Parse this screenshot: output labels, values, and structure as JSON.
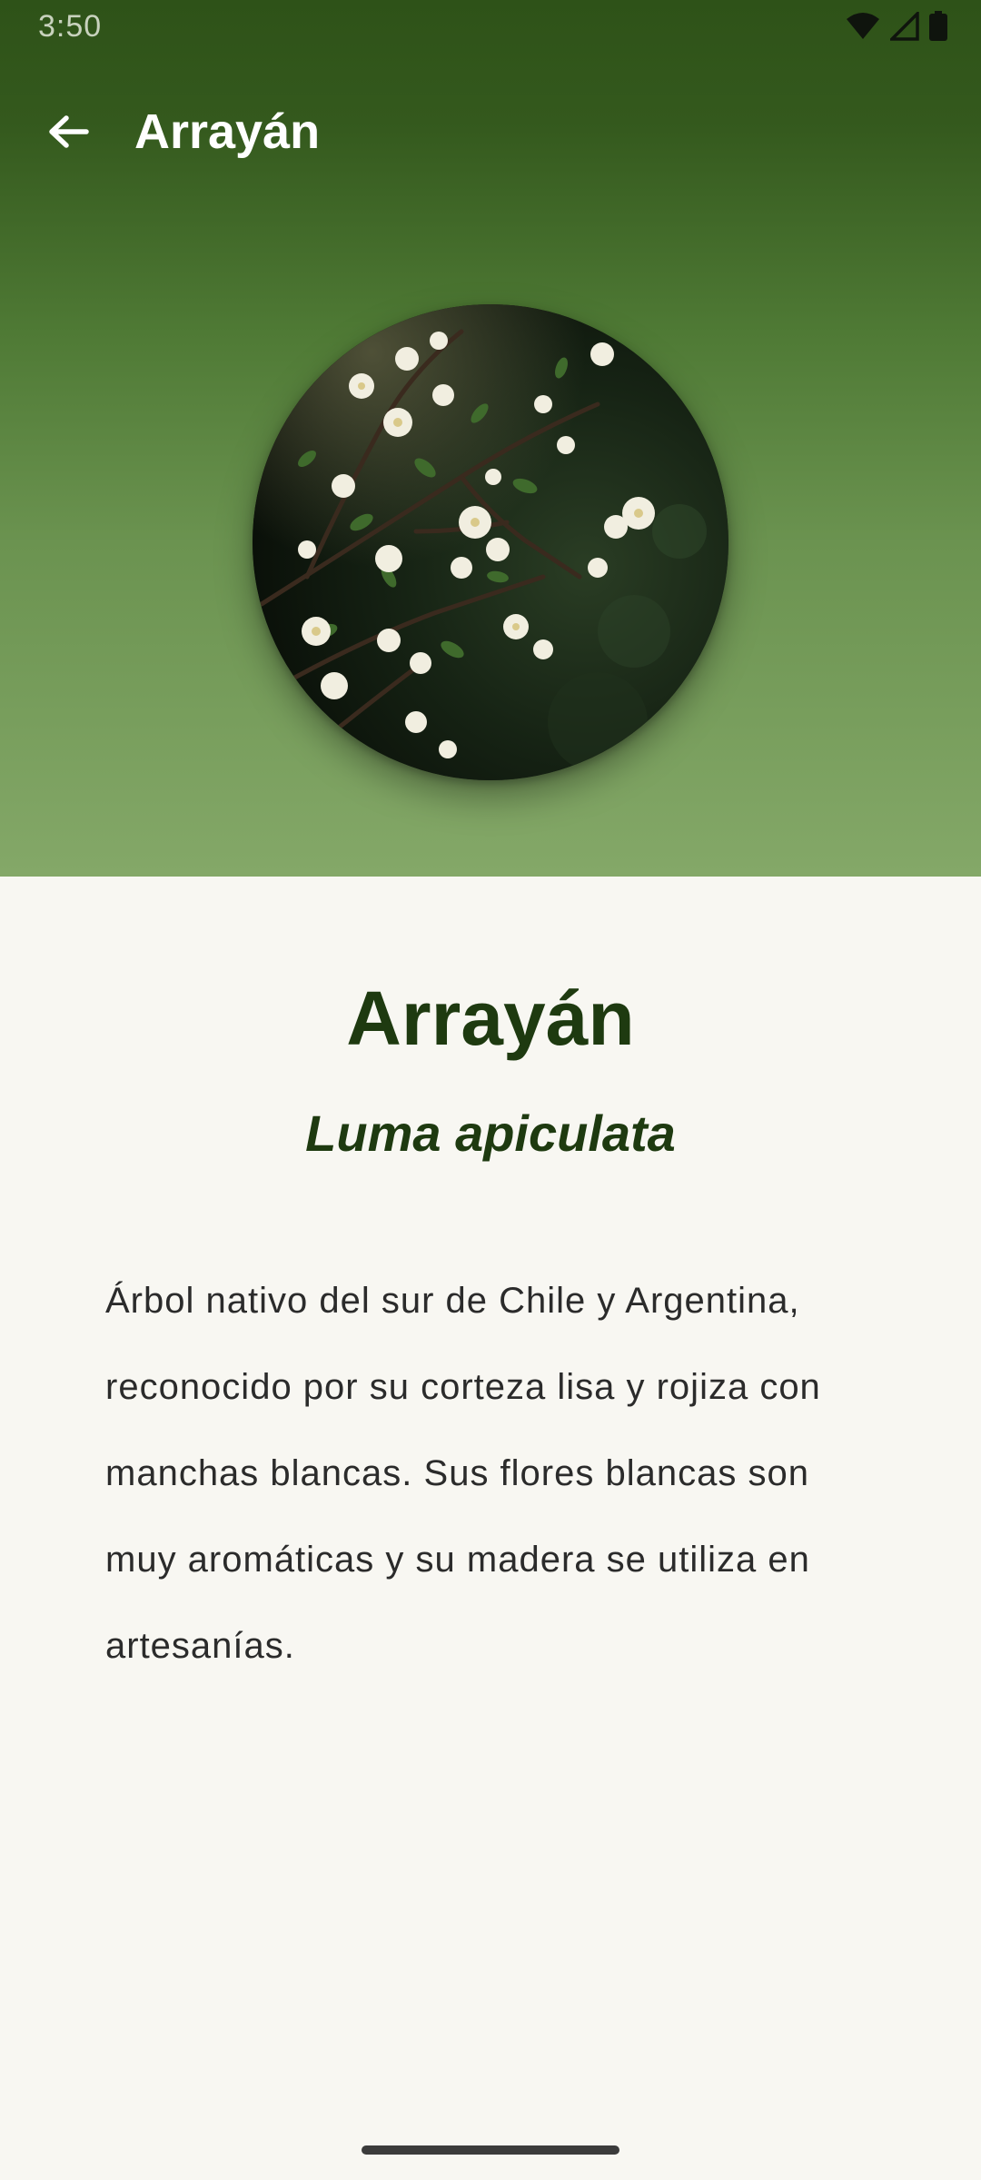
{
  "status_bar": {
    "time": "3:50",
    "icons": [
      "wifi-icon",
      "cell-signal-icon",
      "battery-icon"
    ]
  },
  "app_bar": {
    "back_icon": "arrow-back-icon",
    "title": "Arrayán"
  },
  "plant": {
    "image_alt": "Flores blancas de arrayán",
    "name": "Arrayán",
    "scientific_name": "Luma apiculata",
    "description": "Árbol nativo del sur de Chile y Argentina, reconocido por su corteza lisa y rojiza con manchas blancas. Sus flores blancas son muy aromáticas y su madera se utiliza en artesanías."
  },
  "colors": {
    "header_top": "#2e5218",
    "header_bottom": "#84a868",
    "title_green": "#1e3a10",
    "background": "#f8f7f2"
  }
}
